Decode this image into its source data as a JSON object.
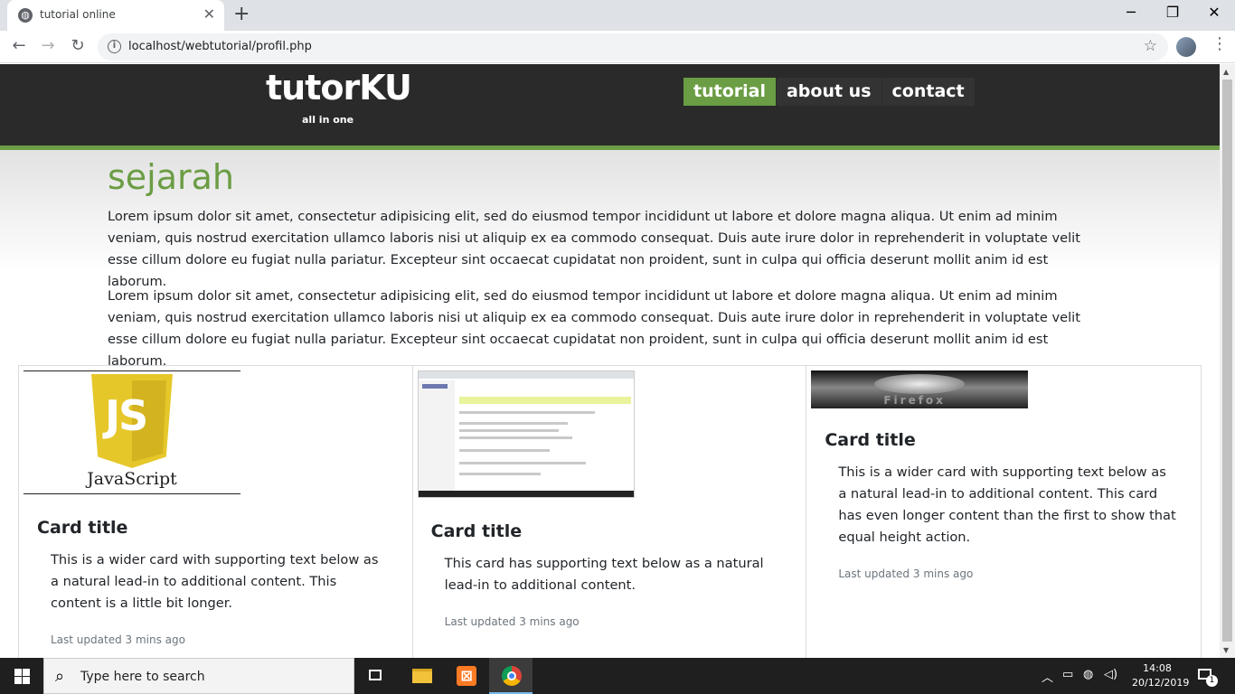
{
  "browser": {
    "tab_title": "tutorial online",
    "url": "localhost/webtutorial/profil.php"
  },
  "site": {
    "logo": "tutorKU",
    "tagline": "all in one",
    "nav": [
      {
        "label": "tutorial",
        "active": true
      },
      {
        "label": "about us",
        "active": false
      },
      {
        "label": "contact",
        "active": false
      }
    ],
    "accent_color": "#6b9d44",
    "header_color": "#2a2a2a"
  },
  "main": {
    "title": "sejarah",
    "paragraphs": [
      "Lorem ipsum dolor sit amet, consectetur adipisicing elit, sed do eiusmod tempor incididunt ut labore et dolore magna aliqua. Ut enim ad minim veniam, quis nostrud exercitation ullamco laboris nisi ut aliquip ex ea commodo consequat. Duis aute irure dolor in reprehenderit in voluptate velit esse cillum dolore eu fugiat nulla pariatur. Excepteur sint occaecat cupidatat non proident, sunt in culpa qui officia deserunt mollit anim id est laborum.",
      "Lorem ipsum dolor sit amet, consectetur adipisicing elit, sed do eiusmod tempor incididunt ut labore et dolore magna aliqua. Ut enim ad minim veniam, quis nostrud exercitation ullamco laboris nisi ut aliquip ex ea commodo consequat. Duis aute irure dolor in reprehenderit in voluptate velit esse cillum dolore eu fugiat nulla pariatur. Excepteur sint occaecat cupidatat non proident, sunt in culpa qui officia deserunt mollit anim id est laborum."
    ]
  },
  "cards": [
    {
      "image_caption": "JavaScript",
      "image_logo": "JS",
      "title": "Card title",
      "text": "This is a wider card with supporting text below as a natural lead-in to additional content. This content is a little bit longer.",
      "muted": "Last updated 3 mins ago"
    },
    {
      "title": "Card title",
      "text": "This card has supporting text below as a natural lead-in to additional content.",
      "muted": "Last updated 3 mins ago"
    },
    {
      "image_caption": "Firefox",
      "title": "Card title",
      "text": "This is a wider card with supporting text below as a natural lead-in to additional content. This card has even longer content than the first to show that equal height action.",
      "muted": "Last updated 3 mins ago"
    }
  ],
  "taskbar": {
    "search_placeholder": "Type here to search",
    "time": "14:08",
    "date": "20/12/2019",
    "notification_count": "1"
  }
}
